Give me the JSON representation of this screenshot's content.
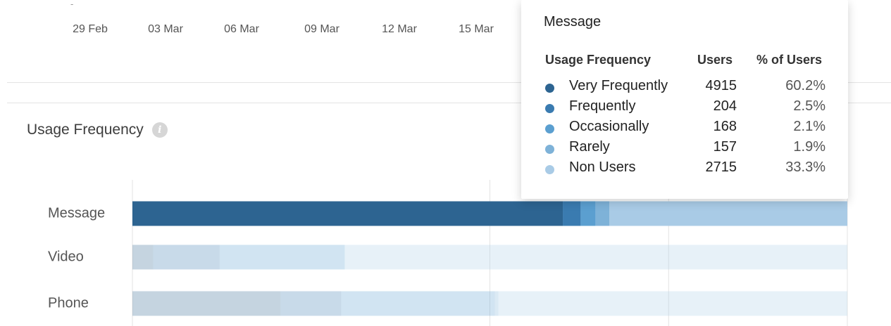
{
  "timeline": {
    "dates": [
      "29 Feb",
      "03 Mar",
      "06 Mar",
      "09 Mar",
      "12 Mar",
      "15 Mar"
    ],
    "stub_label": "-"
  },
  "section": {
    "title": "Usage Frequency",
    "info_icon": "info-icon"
  },
  "tooltip": {
    "title": "Message",
    "columns": [
      "Usage Frequency",
      "Users",
      "% of Users"
    ],
    "rows": [
      {
        "category": "Very Frequently",
        "users": "4915",
        "pct": "60.2%",
        "color": "#2d6491"
      },
      {
        "category": "Frequently",
        "users": "204",
        "pct": "2.5%",
        "color": "#3a7bb0"
      },
      {
        "category": "Occasionally",
        "users": "168",
        "pct": "2.1%",
        "color": "#5b9fd0"
      },
      {
        "category": "Rarely",
        "users": "157",
        "pct": "1.9%",
        "color": "#7eb2d8"
      },
      {
        "category": "Non Users",
        "users": "2715",
        "pct": "33.3%",
        "color": "#a9cbe6"
      }
    ]
  },
  "chart_data": {
    "type": "bar",
    "orientation": "horizontal",
    "stacked": true,
    "categories": [
      "Message",
      "Video",
      "Phone"
    ],
    "series": [
      {
        "name": "Very Frequently",
        "values": [
          60.2,
          2.9,
          20.7
        ],
        "color": "#2d6491"
      },
      {
        "name": "Frequently",
        "values": [
          2.5,
          9.3,
          8.5
        ],
        "color": "#3a7bb0"
      },
      {
        "name": "Occasionally",
        "values": [
          2.1,
          17.5,
          21.5
        ],
        "color": "#5b9fd0"
      },
      {
        "name": "Rarely",
        "values": [
          1.9,
          0,
          0.5
        ],
        "color": "#7eb2d8"
      },
      {
        "name": "Non Users",
        "values": [
          33.3,
          70.3,
          48.8
        ],
        "color": "#a9cbe6"
      }
    ],
    "xlim": [
      0,
      100
    ],
    "gridlines": [
      0,
      50,
      75,
      100
    ],
    "highlighted_category": "Message",
    "faded_categories": [
      "Video",
      "Phone"
    ]
  }
}
